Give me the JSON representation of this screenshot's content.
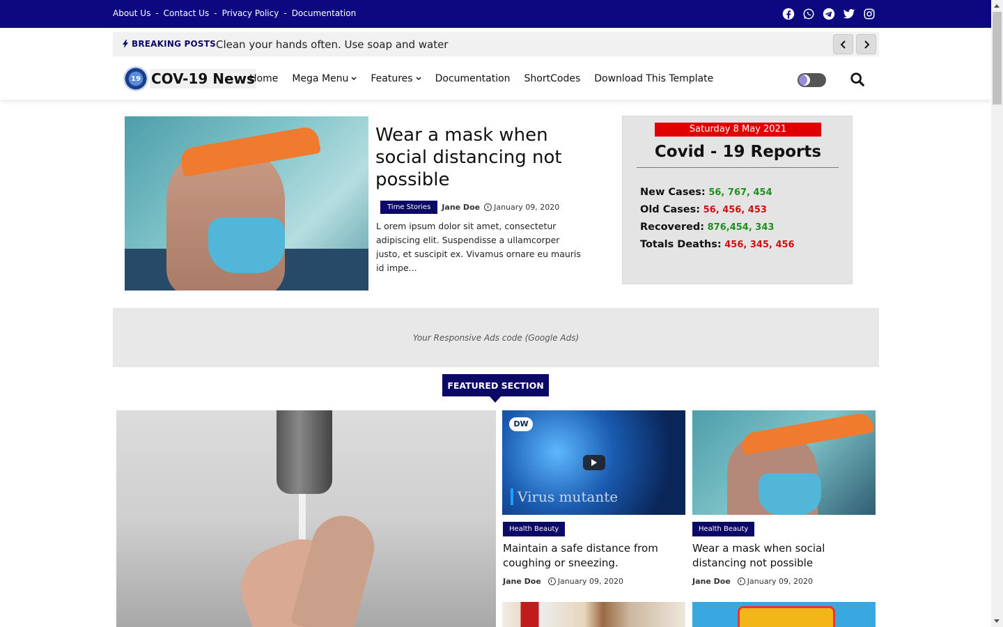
{
  "topbar": {
    "links": [
      "About Us",
      "Contact Us",
      "Privacy Policy",
      "Documentation"
    ],
    "separator": "-",
    "social_icons": [
      "facebook-icon",
      "whatsapp-icon",
      "telegram-icon",
      "twitter-icon",
      "instagram-icon"
    ]
  },
  "breaking": {
    "label": "BREAKING POSTS",
    "text": "Clean your hands often. Use soap and water"
  },
  "nav": {
    "logo_badge": "19",
    "logo_text": "COV-19 News",
    "items": [
      "Home",
      "Mega Menu",
      "Features",
      "Documentation",
      "ShortCodes",
      "Download This Template"
    ]
  },
  "hero": {
    "title": "Wear a mask when social distancing not possible",
    "category": "Time Stories",
    "author": "Jane Doe",
    "date": "January 09, 2020",
    "excerpt": "L orem ipsum dolor sit amet, consectetur adipiscing elit. Suspendisse a ullamcorper justo, et suscipit ex. Vivamus ornare eu mauris id impe..."
  },
  "covid": {
    "date": "Saturday 8 May 2021",
    "title": "Covid - 19 Reports",
    "rows": [
      {
        "label": "New Cases:",
        "value": "56, 767, 454",
        "color": "#1e8e1e"
      },
      {
        "label": "Old Cases:",
        "value": "56, 456, 453",
        "color": "#cc1111"
      },
      {
        "label": "Recovered:",
        "value": "876,454, 343",
        "color": "#1e8e1e"
      },
      {
        "label": "Totals Deaths:",
        "value": "456, 345, 456",
        "color": "#cc1111"
      }
    ]
  },
  "ads": {
    "text": "Your Responsive Ads code (Google Ads)"
  },
  "featured": {
    "label": "FEATURED SECTION",
    "cards": [
      {
        "category": "Health Beauty",
        "title": "Maintain a safe distance from coughing or sneezing.",
        "author": "Jane Doe",
        "date": "January 09, 2020",
        "video_caption": "Virus mutante",
        "video_logo": "DW"
      },
      {
        "category": "Health Beauty",
        "title": "Wear a mask when social distancing not possible",
        "author": "Jane Doe",
        "date": "January 09, 2020"
      }
    ]
  },
  "colors": {
    "brand_navy": "#0c0866",
    "topbar_blue": "#0c0880",
    "alert_red": "#e00000",
    "green": "#1e8e1e",
    "red": "#cc1111"
  }
}
